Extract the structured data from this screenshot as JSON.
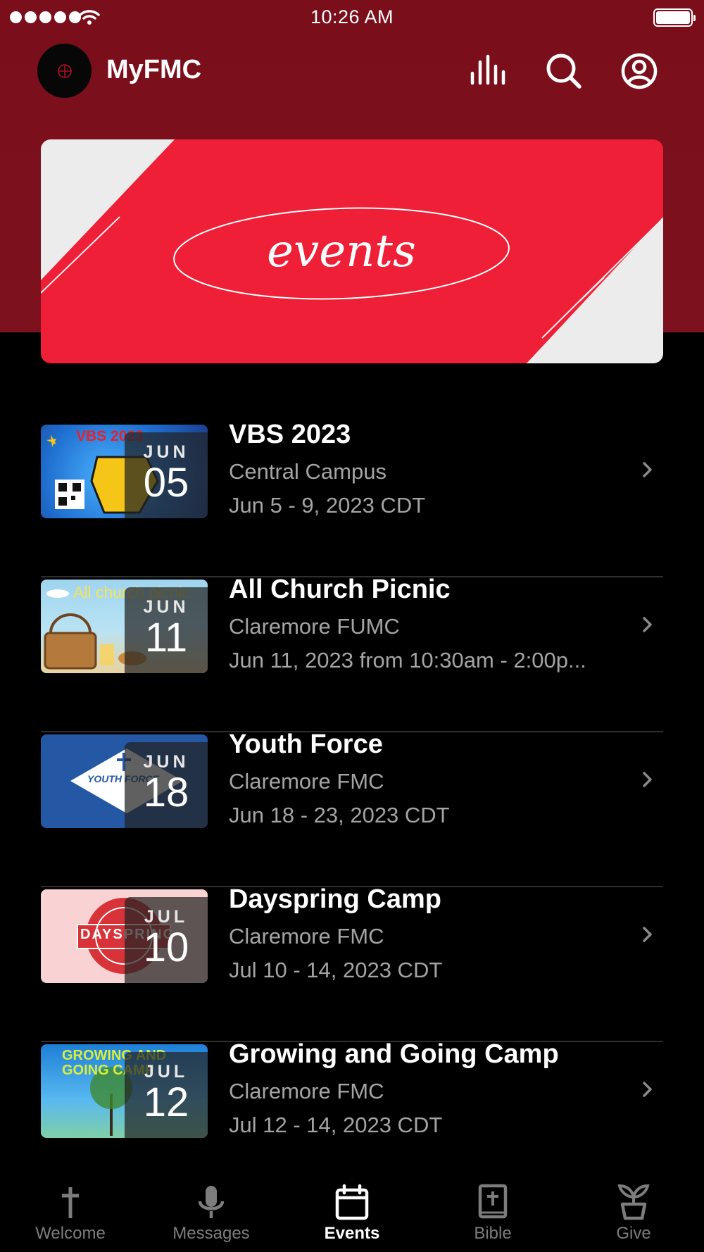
{
  "status_bar": {
    "time": "10:26 AM"
  },
  "header": {
    "title": "MyFMC"
  },
  "banner": {
    "text": "events"
  },
  "events": [
    {
      "title": "VBS 2023",
      "location": "Central Campus",
      "dates": "Jun 5 - 9, 2023 CDT",
      "month": "JUN",
      "day": "05",
      "thumb_text": "VBS 2023"
    },
    {
      "title": "All Church Picnic",
      "location": "Claremore FUMC",
      "dates": "Jun 11, 2023 from 10:30am - 2:00p...",
      "month": "JUN",
      "day": "11",
      "thumb_text": "All church picnic"
    },
    {
      "title": "Youth Force",
      "location": "Claremore FMC",
      "dates": "Jun 18 - 23, 2023 CDT",
      "month": "JUN",
      "day": "18",
      "thumb_text": "YOUTH FORCE"
    },
    {
      "title": "Dayspring Camp",
      "location": "Claremore FMC",
      "dates": "Jul 10 - 14, 2023 CDT",
      "month": "JUL",
      "day": "10",
      "thumb_text": "DAYSPRING"
    },
    {
      "title": "Growing and Going Camp",
      "location": "Claremore FMC",
      "dates": "Jul 12 - 14, 2023 CDT",
      "month": "JUL",
      "day": "12",
      "thumb_text": "GROWING AND GOING CAMP"
    }
  ],
  "tabs": [
    {
      "label": "Welcome",
      "icon": "cross-icon"
    },
    {
      "label": "Messages",
      "icon": "microphone-icon"
    },
    {
      "label": "Events",
      "icon": "calendar-icon",
      "active": true
    },
    {
      "label": "Bible",
      "icon": "bible-icon"
    },
    {
      "label": "Give",
      "icon": "plant-icon"
    }
  ],
  "colors": {
    "header_red": "#7a0e1b",
    "banner_red": "#ee1f36",
    "muted_text": "#a4a4a4"
  }
}
